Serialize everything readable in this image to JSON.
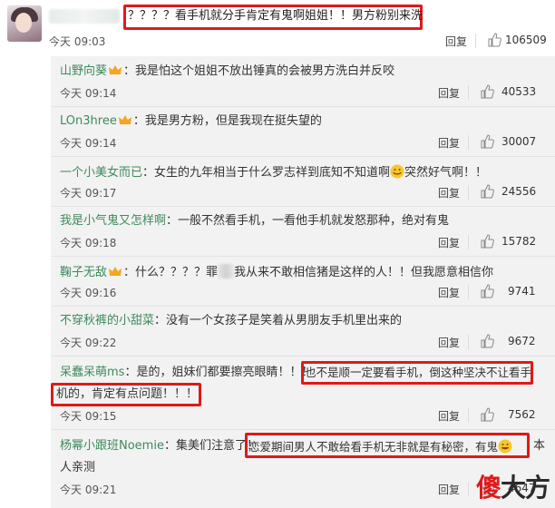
{
  "top_comment": {
    "text": "？？？？看手机就分手肯定有鬼啊姐姐！！男方粉别来洗",
    "time": "今天 09:03",
    "reply": "回复",
    "likes": "106509"
  },
  "replies": [
    {
      "user": "山野向葵",
      "text": "：我是怕这个姐姐不放出锤真的会被男方洗白并反咬",
      "time": "今天 09:14",
      "reply": "回复",
      "likes": "40533"
    },
    {
      "user": "LOn3hree",
      "text": "：我是男方粉，但是我现在挺失望的",
      "time": "今天 09:14",
      "reply": "回复",
      "likes": "30007"
    },
    {
      "user": "一个小美女而已",
      "text": "：女生的九年相当于什么罗志祥到底知不知道啊",
      "text2": "突然好气啊！！",
      "time": "今天 09:17",
      "reply": "回复",
      "likes": "24556"
    },
    {
      "user": "我是小气鬼又怎样啊",
      "text": "：一般不然看手机，一看他手机就发怒那种，绝对有鬼",
      "time": "今天 09:18",
      "reply": "回复",
      "likes": "15782"
    },
    {
      "user": "鞠子无敌",
      "text": "：什么？？？？罪",
      "text2": "我从来不敢相信猪是这样的人！！但我愿意相信你",
      "time": "今天 09:16",
      "reply": "回复",
      "likes": "9741"
    },
    {
      "user": "不穿秋裤的小甜菜",
      "text": "：没有一个女孩子是笑着从男朋友手机里出来的",
      "time": "今天 09:22",
      "reply": "回复",
      "likes": "9672"
    },
    {
      "user": "呆蠢呆萌ms",
      "text": "：是的，姐妹们都要擦亮眼睛！！！",
      "boxed1": "也不是顺一定要看手机，倒这种坚决不让看手",
      "boxed2": "机的，肯定有点问题！！！",
      "time": "今天 09:15",
      "reply": "回复",
      "likes": "7562"
    },
    {
      "user": "杨幂小跟班Noemie",
      "text": "：集美们注意了！",
      "boxed": "恋爱期间男人不敢给看手机无非就是有秘密，有鬼",
      "text3": "本",
      "line2": "人亲测",
      "time": "今天 09:21",
      "reply": "回复",
      "likes": "4647"
    }
  ],
  "watermark": {
    "red": "傻",
    "black": "大方"
  },
  "colors": {
    "highlight": "#e01919",
    "username": "#eb7350"
  }
}
